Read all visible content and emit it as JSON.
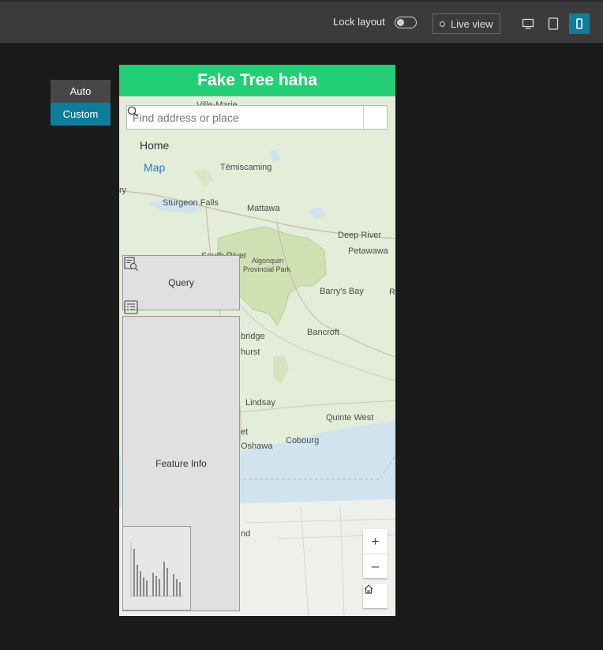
{
  "toolbar": {
    "lock_label": "Lock layout",
    "live_view_label": "Live view",
    "devices": [
      "desktop-icon",
      "tablet-icon",
      "phone-icon"
    ],
    "active_device": "phone-icon",
    "accent": "#0e7d9a"
  },
  "layout_switcher": {
    "auto_label": "Auto",
    "custom_label": "Custom",
    "selected": "Custom"
  },
  "app": {
    "title": "Fake Tree haha",
    "header_color": "#22cf74",
    "search_placeholder": "Find address or place",
    "nav": {
      "home": "Home",
      "map": "Map"
    },
    "widgets": {
      "query": "Query",
      "feature_info": "Feature Info"
    },
    "zoom_in": "+",
    "zoom_out": "–"
  },
  "map_labels": {
    "ville_marie": "Ville-Marie",
    "temiscaming": "Témiscaming",
    "ry": "ry",
    "sturgeon_falls": "Sturgeon Falls",
    "mattawa": "Mattawa",
    "deep_river": "Deep River",
    "petawawa": "Petawawa",
    "south_river": "South River",
    "algonquin": "Algonquin",
    "provincial_park": "Provincial Park",
    "barrys_bay": "Barry's Bay",
    "r": "R",
    "bancroft": "Bancroft",
    "bridge": "bridge",
    "hurst": "hurst",
    "lindsay": "Lindsay",
    "quinte_west": "Quinte West",
    "et": "et",
    "oshawa": "Oshawa",
    "cobourg": "Cobourg",
    "nd": "nd"
  }
}
